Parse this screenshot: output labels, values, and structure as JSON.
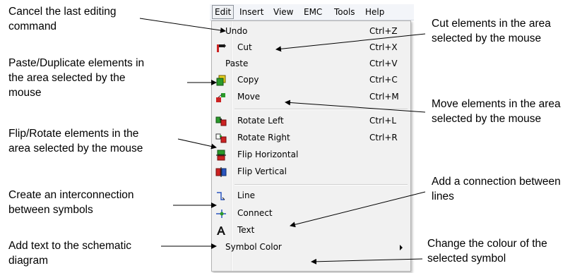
{
  "menubar": {
    "items": [
      "Edit",
      "Insert",
      "View",
      "EMC",
      "Tools",
      "Help"
    ]
  },
  "menu": {
    "items": [
      {
        "label": "Undo",
        "shortcut": "Ctrl+Z",
        "icon": "undo-icon"
      },
      {
        "label": "Cut",
        "shortcut": "Ctrl+X",
        "icon": "cut-icon"
      },
      {
        "label": "Paste",
        "shortcut": "Ctrl+V",
        "icon": "paste-icon"
      },
      {
        "label": "Copy",
        "shortcut": "Ctrl+C",
        "icon": "copy-icon"
      },
      {
        "label": "Move",
        "shortcut": "Ctrl+M",
        "icon": "move-icon"
      },
      {
        "label": "Rotate Left",
        "shortcut": "Ctrl+L",
        "icon": "rotate-left-icon"
      },
      {
        "label": "Rotate Right",
        "shortcut": "Ctrl+R",
        "icon": "rotate-right-icon"
      },
      {
        "label": "Flip Horizontal",
        "shortcut": "",
        "icon": "flip-horizontal-icon"
      },
      {
        "label": "Flip Vertical",
        "shortcut": "",
        "icon": "flip-vertical-icon"
      },
      {
        "label": "Line",
        "shortcut": "",
        "icon": "line-icon"
      },
      {
        "label": "Connect",
        "shortcut": "",
        "icon": "connect-icon"
      },
      {
        "label": "Text",
        "shortcut": "",
        "icon": "text-icon"
      },
      {
        "label": "Symbol Color",
        "shortcut": "",
        "icon": "submenu-arrow-icon"
      }
    ]
  },
  "annotations": {
    "undo": "Cancel the last editing\ncommand",
    "paste": "Paste/Duplicate elements in\nthe area selected by the\nmouse",
    "flip": "Flip/Rotate elements in the\narea selected by the mouse",
    "line": "Create an interconnection\nbetween symbols",
    "text": "Add text to the schematic\ndiagram",
    "cut": "Cut elements in the area\nselected by the mouse",
    "move": "Move elements in the area\nselected by the mouse",
    "connect": "Add a connection between\nlines",
    "color": "Change the colour of the\nselected symbol"
  },
  "colors": {
    "menu_bg": "#f1f1f1",
    "icon_red": "#cc2222",
    "icon_green": "#2a9a2a",
    "icon_blue": "#2a55c0"
  }
}
